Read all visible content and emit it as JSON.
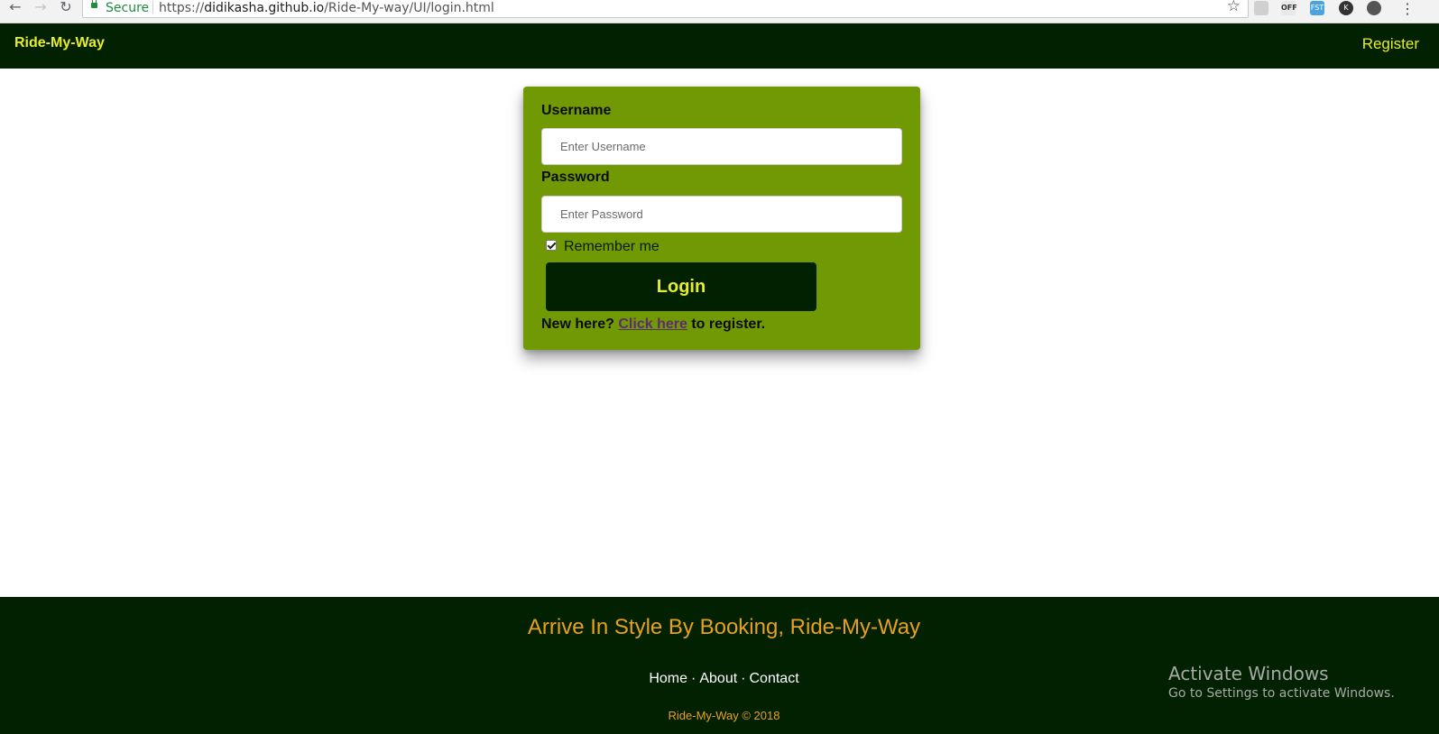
{
  "browser": {
    "secure_label": "Secure",
    "url_scheme": "https://",
    "url_host": "didikasha.github.io",
    "url_path": "/Ride-My-way/UI/login.html",
    "extension_off_label": "OFF",
    "extension_fst_label": "FST",
    "extension_k_label": "K"
  },
  "navbar": {
    "brand": "Ride-My-Way",
    "register_link": "Register",
    "brand_color": "#e8ec2b",
    "background": "#012101"
  },
  "login_form": {
    "username_label": "Username",
    "username_placeholder": "Enter Username",
    "username_value": "",
    "password_label": "Password",
    "password_placeholder": "Enter Password",
    "password_value": "",
    "remember_label": "Remember me",
    "remember_checked": true,
    "login_button": "Login",
    "register_prefix": "New here?",
    "register_link": "Click here",
    "register_suffix": "to register.",
    "card_color": "#709904"
  },
  "footer": {
    "tagline": "Arrive In Style By Booking, Ride-My-Way",
    "links": [
      "Home",
      "About",
      "Contact"
    ],
    "separator": "·",
    "copyright": "Ride-My-Way © 2018",
    "accent_color": "#eaa01c"
  },
  "windows_watermark": {
    "title": "Activate Windows",
    "subtitle": "Go to Settings to activate Windows."
  }
}
